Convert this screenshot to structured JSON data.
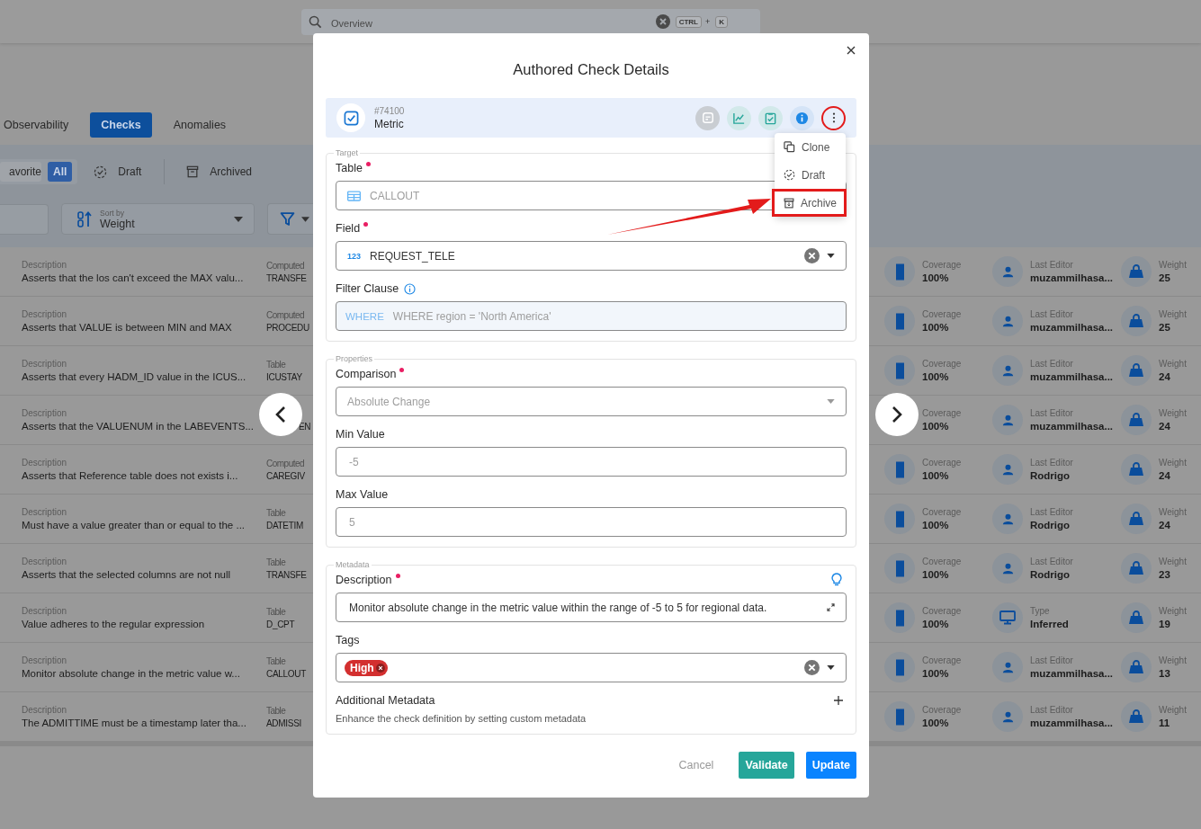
{
  "search": {
    "placeholder": "Overview",
    "keys": [
      {
        "label": "CTRL",
        "kind": "key"
      },
      {
        "label": "+",
        "kind": "separator"
      },
      {
        "label": "K",
        "kind": "key"
      }
    ]
  },
  "tabs": [
    {
      "label": "Observability",
      "selected": false
    },
    {
      "label": "Checks",
      "selected": true
    },
    {
      "label": "Anomalies",
      "selected": false
    }
  ],
  "status_filter": {
    "segments": [
      {
        "label": "avorite",
        "selected": false
      },
      {
        "label": "All",
        "selected": true
      }
    ],
    "options": [
      {
        "label": "Draft",
        "kind": "draft"
      },
      {
        "label": "Archived",
        "kind": "archived"
      }
    ]
  },
  "sort": {
    "label": "Sort by",
    "value": "Weight"
  },
  "checks": [
    {
      "description_label": "Description",
      "description": "Asserts that the los can't exceed the MAX valu...",
      "source_label": "Computed",
      "source": "TRANSFE",
      "coverage_label": "Coverage",
      "coverage": "100%",
      "kind": "editor",
      "meta_label": "Last Editor",
      "meta": "muzammilhasa...",
      "weight_label": "Weight",
      "weight": "25"
    },
    {
      "description_label": "Description",
      "description": "Asserts that VALUE is between MIN and MAX",
      "source_label": "Computed",
      "source": "PROCEDU",
      "coverage_label": "Coverage",
      "coverage": "100%",
      "kind": "editor",
      "meta_label": "Last Editor",
      "meta": "muzammilhasa...",
      "weight_label": "Weight",
      "weight": "25"
    },
    {
      "description_label": "Description",
      "description": "Asserts that every HADM_ID value in the ICUS...",
      "source_label": "Table",
      "source": "ICUSTAY",
      "coverage_label": "Coverage",
      "coverage": "100%",
      "kind": "editor",
      "meta_label": "Last Editor",
      "meta": "muzammilhasa...",
      "weight_label": "Weight",
      "weight": "24"
    },
    {
      "description_label": "Description",
      "description": "Asserts that the VALUENUM in the LABEVENTS...",
      "source": "EN",
      "coverage_label": "Coverage",
      "coverage": "100%",
      "kind": "editor",
      "meta_label": "Last Editor",
      "meta": "muzammilhasa...",
      "weight_label": "Weight",
      "weight": "24"
    },
    {
      "description_label": "Description",
      "description": "Asserts that Reference table does not exists i...",
      "source_label": "Computed",
      "source": "CAREGIV",
      "coverage_label": "Coverage",
      "coverage": "100%",
      "kind": "editor",
      "meta_label": "Last Editor",
      "meta": "Rodrigo",
      "weight_label": "Weight",
      "weight": "24"
    },
    {
      "description_label": "Description",
      "description": "Must have a value greater than or equal to the ...",
      "source_label": "Table",
      "source": "DATETIM",
      "coverage_label": "Coverage",
      "coverage": "100%",
      "kind": "editor",
      "meta_label": "Last Editor",
      "meta": "Rodrigo",
      "weight_label": "Weight",
      "weight": "24"
    },
    {
      "description_label": "Description",
      "description": "Asserts that the selected columns are not null",
      "source_label": "Table",
      "source": "TRANSFE",
      "coverage_label": "Coverage",
      "coverage": "100%",
      "kind": "editor",
      "meta_label": "Last Editor",
      "meta": "Rodrigo",
      "weight_label": "Weight",
      "weight": "23"
    },
    {
      "description_label": "Description",
      "description": "Value adheres to the regular expression",
      "source_label": "Table",
      "source": "D_CPT",
      "coverage_label": "Coverage",
      "coverage": "100%",
      "kind": "type",
      "meta_label": "Type",
      "meta": "Inferred",
      "weight_label": "Weight",
      "weight": "19"
    },
    {
      "description_label": "Description",
      "description": "Monitor absolute change in the metric value w...",
      "source_label": "Table",
      "source": "CALLOUT",
      "coverage_label": "Coverage",
      "coverage": "100%",
      "kind": "editor",
      "meta_label": "Last Editor",
      "meta": "muzammilhasa...",
      "weight_label": "Weight",
      "weight": "13"
    },
    {
      "description_label": "Description",
      "description": "The ADMITTIME must be a timestamp later tha...",
      "source_label": "Table",
      "source": "ADMISSI",
      "coverage_label": "Coverage",
      "coverage": "100%",
      "kind": "editor",
      "meta_label": "Last Editor",
      "meta": "muzammilhasa...",
      "weight_label": "Weight",
      "weight": "11"
    }
  ],
  "modal": {
    "title": "Authored Check Details",
    "check": {
      "id": "#74100",
      "type": "Metric"
    },
    "more_circled": true,
    "menu": [
      {
        "label": "Clone",
        "kind": "clone",
        "highlighted": false
      },
      {
        "label": "Draft",
        "kind": "draft",
        "highlighted": false
      },
      {
        "label": "Archive",
        "kind": "archive",
        "highlighted": true
      }
    ],
    "sections": [
      {
        "legend": "Target",
        "fields": [
          {
            "label": "Table",
            "required": true,
            "kind": "table",
            "value": "CALLOUT",
            "disabled": true
          },
          {
            "label": "Field",
            "required": true,
            "kind": "field",
            "prefix": "123",
            "value": "REQUEST_TELE",
            "disabled": false
          },
          {
            "label": "Filter Clause",
            "required": false,
            "info": true,
            "kind": "filter",
            "prefix": "WHERE",
            "value": "WHERE region = 'North America'",
            "disabled": true
          }
        ]
      },
      {
        "legend": "Properties",
        "fields": [
          {
            "label": "Comparison",
            "required": true,
            "kind": "select",
            "value": "Absolute Change",
            "disabled": true
          },
          {
            "label": "Min Value",
            "required": false,
            "kind": "input",
            "value": "-5",
            "disabled": true
          },
          {
            "label": "Max Value",
            "required": false,
            "kind": "input",
            "value": "5",
            "disabled": true
          }
        ]
      },
      {
        "legend": "Metadata",
        "fields": [
          {
            "label": "Description",
            "required": true,
            "suggest": true,
            "kind": "textarea",
            "value": "Monitor absolute change in the metric value within the range of -5 to 5 for regional data.",
            "disabled": false
          },
          {
            "label": "Tags",
            "required": false,
            "kind": "tags",
            "disabled": false,
            "tags": [
              {
                "label": "High",
                "color": "#d32f2f"
              }
            ]
          }
        ],
        "extra": {
          "title": "Additional Metadata",
          "hint": "Enhance the check definition by setting custom metadata"
        }
      }
    ],
    "buttons": [
      {
        "label": "Cancel",
        "kind": "text"
      },
      {
        "label": "Validate",
        "kind": "validate"
      },
      {
        "label": "Update",
        "kind": "primary"
      }
    ]
  }
}
